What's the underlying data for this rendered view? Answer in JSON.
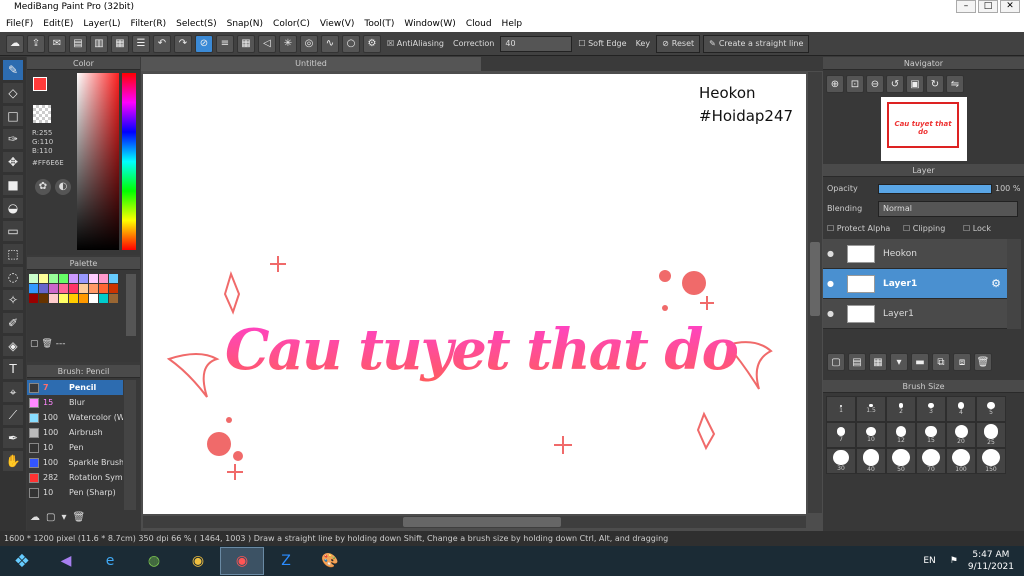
{
  "app": {
    "title": "MediBang Paint Pro (32bit)"
  },
  "menu": [
    "File(F)",
    "Edit(E)",
    "Layer(L)",
    "Filter(R)",
    "Select(S)",
    "Snap(N)",
    "Color(C)",
    "View(V)",
    "Tool(T)",
    "Window(W)",
    "Cloud",
    "Help"
  ],
  "toolbar": {
    "antialias": "AntiAliasing",
    "correction_label": "Correction",
    "correction_value": "40",
    "soft_edge": "Soft Edge",
    "key_label": "Key",
    "reset": "Reset",
    "straight": "Create a straight line"
  },
  "color": {
    "title": "Color",
    "r": "R:255",
    "g": "G:110",
    "b": "B:110",
    "hex": "#FF6E6E",
    "main": "#ff3b3b"
  },
  "palette": {
    "title": "Palette",
    "colors": [
      "#ccffcc",
      "#ffff99",
      "#99ff99",
      "#66ff66",
      "#cc99ff",
      "#9999ff",
      "#ffccff",
      "#ff99cc",
      "#66ccff",
      "#3399ff",
      "#6666cc",
      "#cc66cc",
      "#ff6699",
      "#ff3366",
      "#ffcc99",
      "#ff9966",
      "#ff6633",
      "#cc3300",
      "#990000",
      "#663300",
      "#ffcccc",
      "#ffff66",
      "#ffcc00",
      "#ff9900",
      "#ffffff",
      "#00cccc",
      "#996633"
    ]
  },
  "brush": {
    "title": "Brush: Pencil",
    "items": [
      {
        "size": "7",
        "name": "Pencil",
        "color": "#3a3a3a"
      },
      {
        "size": "15",
        "name": "Blur",
        "color": "#ff88ff"
      },
      {
        "size": "100",
        "name": "Watercolor (W",
        "color": "#88ddff"
      },
      {
        "size": "100",
        "name": "Airbrush",
        "color": "#bbbbbb"
      },
      {
        "size": "10",
        "name": "Pen",
        "color": "#333333"
      },
      {
        "size": "100",
        "name": "Sparkle Brush",
        "color": "#3355ff"
      },
      {
        "size": "282",
        "name": "Rotation Sym",
        "color": "#ff3333"
      },
      {
        "size": "10",
        "name": "Pen (Sharp)",
        "color": "#333333"
      }
    ]
  },
  "canvas": {
    "tab": "Untitled",
    "heading": "Cau tuyet that do",
    "watermark1": "Heokon",
    "watermark2": "#Hoidap247"
  },
  "navigator": {
    "title": "Navigator"
  },
  "layer": {
    "title": "Layer",
    "opacity_label": "Opacity",
    "opacity_value": "100 %",
    "opacity": 1.0,
    "blending_label": "Blending",
    "blending_value": "Normal",
    "protect": "Protect Alpha",
    "clipping": "Clipping",
    "lock": "Lock",
    "items": [
      "Heokon",
      "Layer1",
      "Layer1"
    ]
  },
  "brushsize": {
    "title": "Brush Size",
    "labels": [
      "1",
      "1.5",
      "2",
      "3",
      "4",
      "5",
      "7",
      "10",
      "12",
      "15",
      "20",
      "25",
      "30",
      "40",
      "50",
      "70",
      "100",
      "150"
    ]
  },
  "status": {
    "text": "1600 * 1200 pixel  (11.6 * 8.7cm)  350 dpi  66 %  ( 1464, 1003 )  Draw a straight line by holding down Shift, Change a brush size by holding down Ctrl, Alt, and dragging"
  },
  "clock": {
    "time": "5:47 AM",
    "date": "9/11/2021",
    "lang": "EN"
  }
}
